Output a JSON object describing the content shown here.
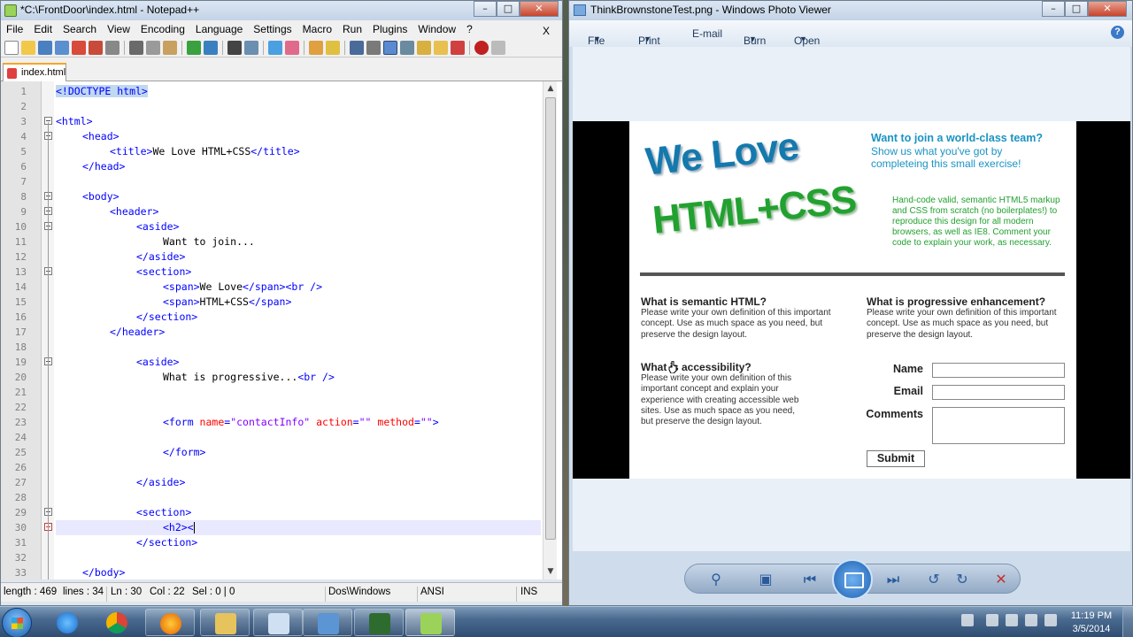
{
  "notepad": {
    "title": "*C:\\FrontDoor\\index.html - Notepad++",
    "menu": [
      "File",
      "Edit",
      "Search",
      "View",
      "Encoding",
      "Language",
      "Settings",
      "Macro",
      "Run",
      "Plugins",
      "Window",
      "?"
    ],
    "menu_close": "X",
    "tab_label": "index.html",
    "lines": [
      {
        "n": "1"
      },
      {
        "n": "2"
      },
      {
        "n": "3"
      },
      {
        "n": "4"
      },
      {
        "n": "5"
      },
      {
        "n": "6"
      },
      {
        "n": "7"
      },
      {
        "n": "8"
      },
      {
        "n": "9"
      },
      {
        "n": "10"
      },
      {
        "n": "11"
      },
      {
        "n": "12"
      },
      {
        "n": "13"
      },
      {
        "n": "14"
      },
      {
        "n": "15"
      },
      {
        "n": "16"
      },
      {
        "n": "17"
      },
      {
        "n": "18"
      },
      {
        "n": "19"
      },
      {
        "n": "20"
      },
      {
        "n": "21"
      },
      {
        "n": "22"
      },
      {
        "n": "23"
      },
      {
        "n": "24"
      },
      {
        "n": "25"
      },
      {
        "n": "26"
      },
      {
        "n": "27"
      },
      {
        "n": "28"
      },
      {
        "n": "29"
      },
      {
        "n": "30"
      },
      {
        "n": "31"
      },
      {
        "n": "32"
      },
      {
        "n": "33"
      }
    ],
    "code": {
      "l1": "<!DOCTYPE html>",
      "l3": "<html>",
      "l4": "<head>",
      "l5a": "<title>",
      "l5b": "We Love HTML+CSS",
      "l5c": "</title>",
      "l6": "</head>",
      "l8": "<body>",
      "l9": "<header>",
      "l10": "<aside>",
      "l11": "Want to join...",
      "l12": "</aside>",
      "l13": "<section>",
      "l14a": "<span>",
      "l14b": "We Love",
      "l14c": "</span><br />",
      "l15a": "<span>",
      "l15b": "HTML+CSS",
      "l15c": "</span>",
      "l16": "</section>",
      "l17": "</header>",
      "l19": "<aside>",
      "l20a": "What is progressive...",
      "l20b": "<br />",
      "l23a": "<form ",
      "l23b": "name",
      "l23c": "=",
      "l23d": "\"contactInfo\"",
      "l23e": " action",
      "l23f": "=",
      "l23g": "\"\"",
      "l23h": " method",
      "l23i": "=",
      "l23j": "\"\"",
      "l23k": ">",
      "l25": "</form>",
      "l27": "</aside>",
      "l29": "<section>",
      "l30": "<h2><",
      "l31": "</section>",
      "l33": "</body>"
    },
    "status": {
      "length": "length : 469",
      "lines": "lines : 34",
      "ln": "Ln : 30",
      "col": "Col : 22",
      "sel": "Sel : 0 | 0",
      "eol": "Dos\\Windows",
      "enc": "ANSI",
      "mode": "INS"
    }
  },
  "viewer": {
    "title": "ThinkBrownstoneTest.png - Windows Photo Viewer",
    "menu": {
      "file": "File",
      "print": "Print",
      "email": "E-mail",
      "burn": "Burn",
      "open": "Open"
    },
    "help": "?",
    "design": {
      "we_love": "We Love",
      "html_css": "HTML+CSS",
      "want_heading": "Want to join a world-class team?",
      "want_text": "Show us what you've got by completeing this small exercise!",
      "hand_code": "Hand-code valid, semantic HTML5 markup and CSS from scratch (no boilerplates!) to reproduce this design for all modern browsers, as well as IE8. Comment your code to explain your work, as necessary.",
      "q1": "What is semantic HTML?",
      "q1_text": "Please write your own definition of this important concept. Use as much space as you need, but preserve the design layout.",
      "q2": "What is progressive enhancement?",
      "q2_text": "Please write your own definition of this important concept. Use as much space as you need, but preserve the design layout.",
      "q3": "What is accessibility?",
      "q3_text": "Please write your own definition of this important concept and explain your experience with creating accessible web sites. Use as much space as you need, but preserve the design layout.",
      "name_label": "Name",
      "email_label": "Email",
      "comments_label": "Comments",
      "submit": "Submit"
    }
  },
  "taskbar": {
    "time": "11:19 PM",
    "date": "3/5/2014"
  },
  "colors": {
    "tag": "#0000ff",
    "attr": "#ff0000",
    "string": "#8000ff",
    "design_blue": "#1b93c4",
    "design_green": "#22a130"
  }
}
